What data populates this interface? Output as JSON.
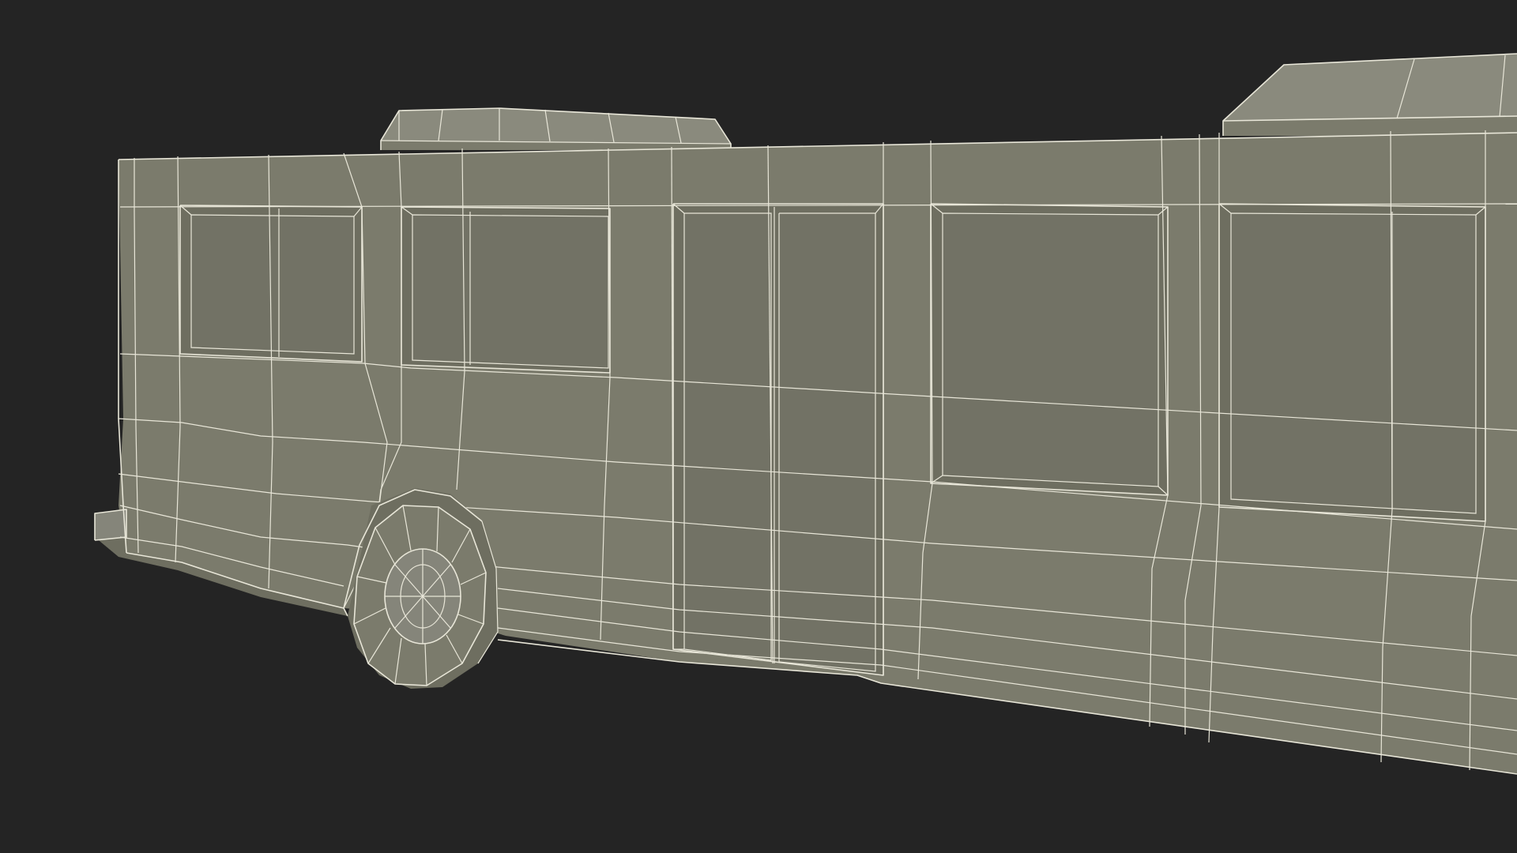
{
  "scene": {
    "subject": "bus-wireframe",
    "background_color": "#242424",
    "surface_color": "#7b7b6c",
    "wire_color": "#e8e6d8"
  }
}
